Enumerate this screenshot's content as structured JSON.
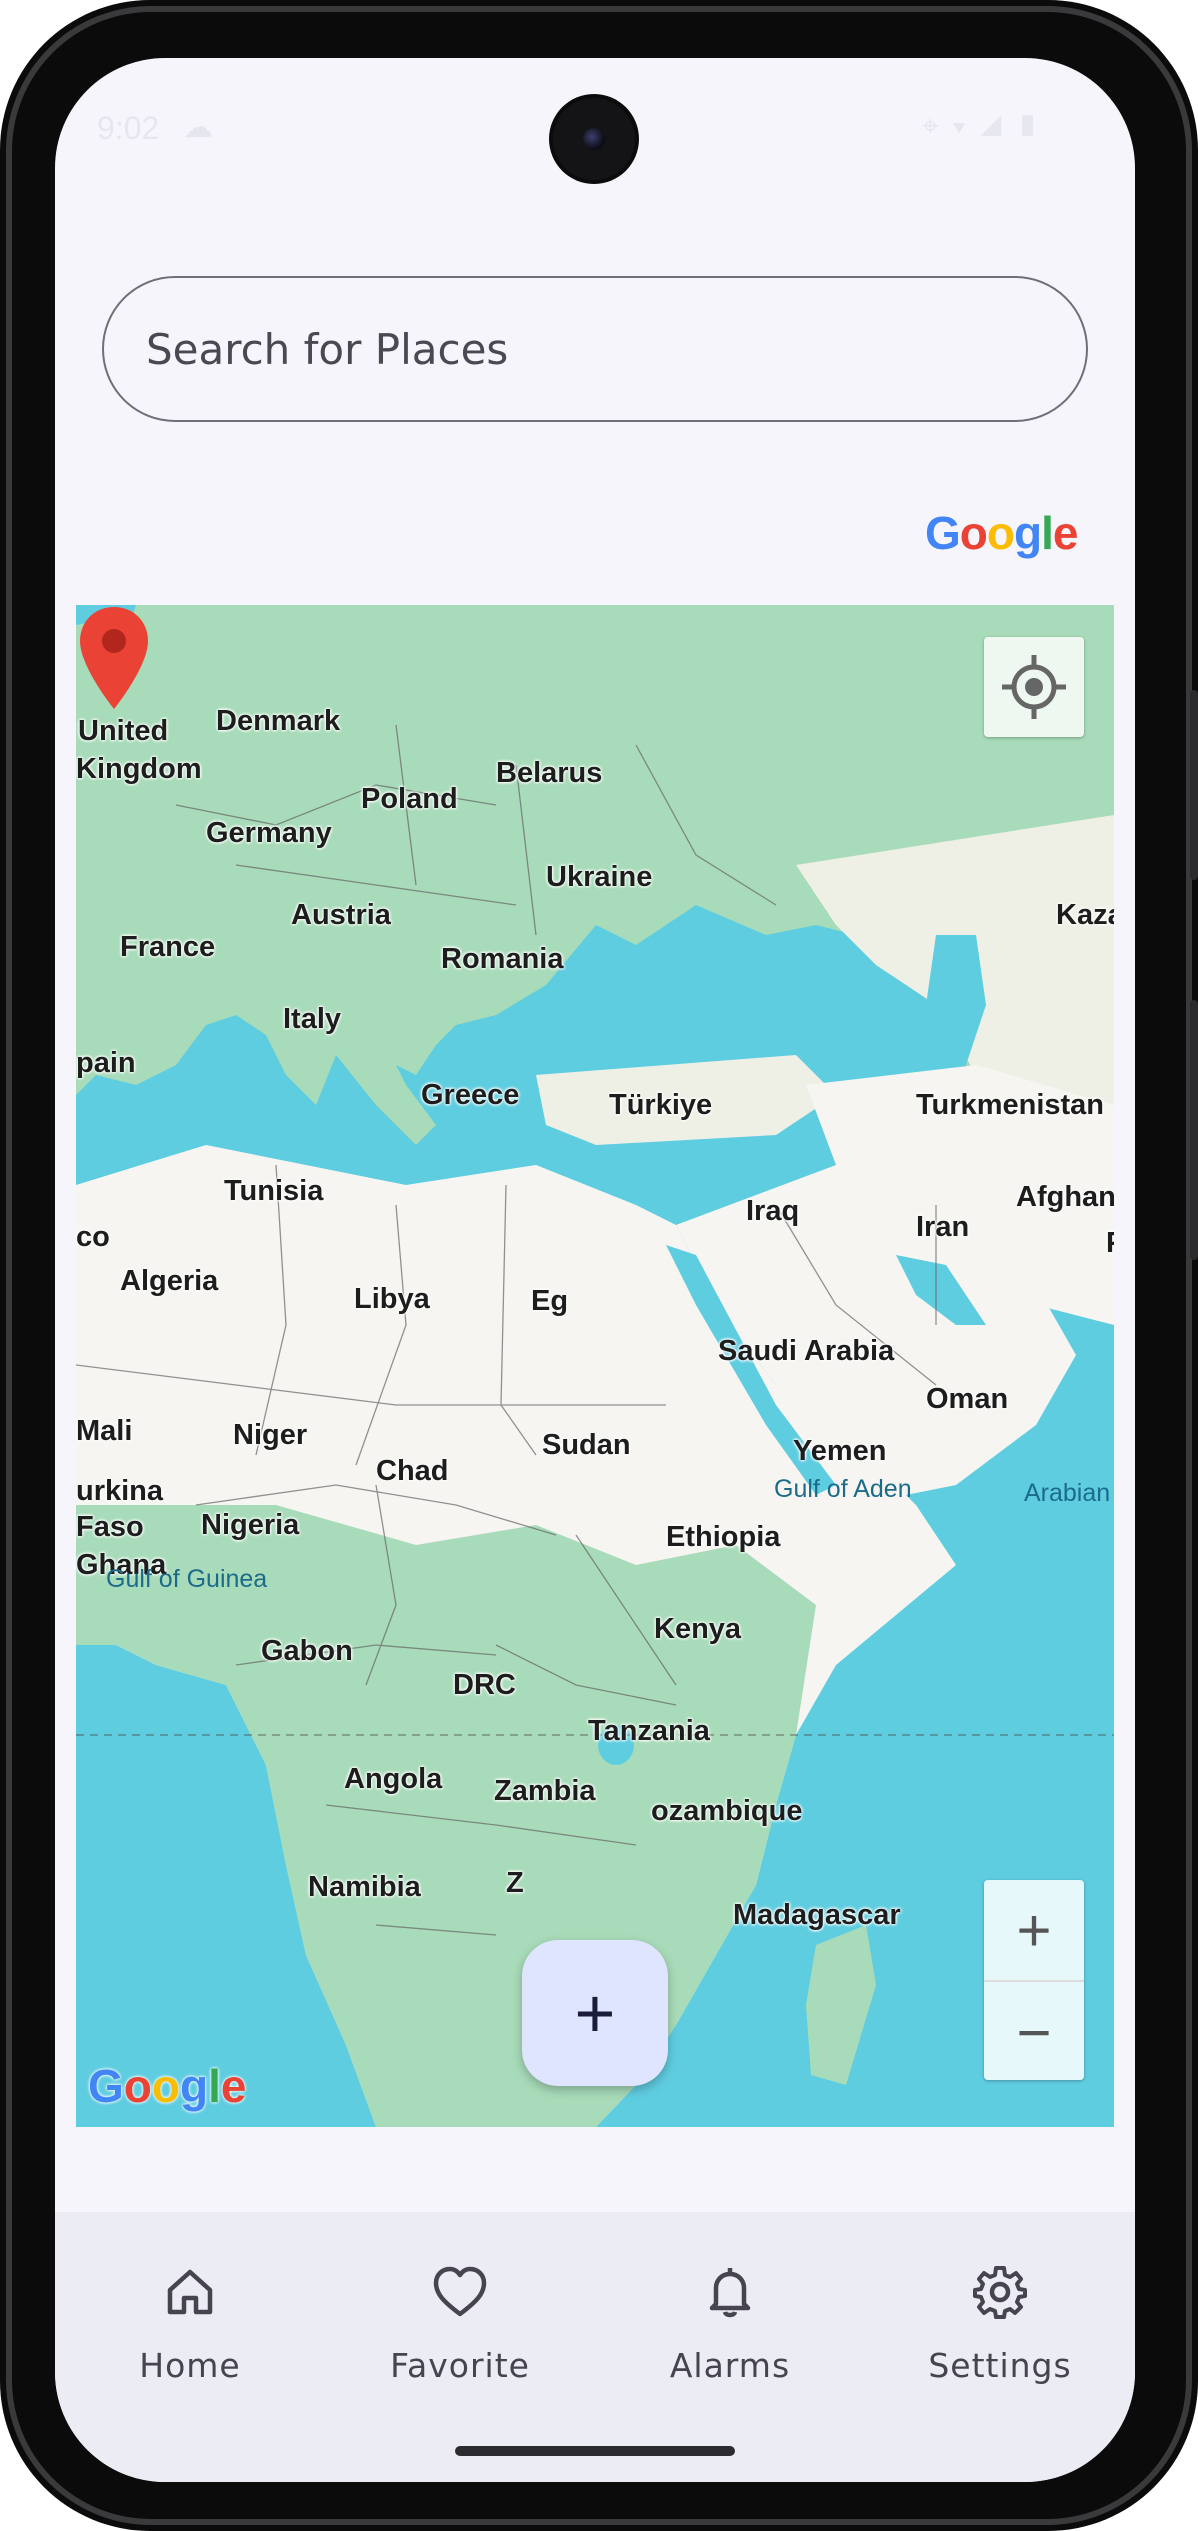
{
  "status_bar": {
    "time": "9:02"
  },
  "search": {
    "placeholder": "Search for Places"
  },
  "attribution": {
    "google": "Google"
  },
  "map": {
    "countries": [
      "United Kingdom",
      "Denmark",
      "Belarus",
      "Poland",
      "Germany",
      "Ukraine",
      "Austria",
      "France",
      "Romania",
      "Italy",
      "Spain",
      "Greece",
      "Türkiye",
      "Turkmenistan",
      "Kazakhstan",
      "Tunisia",
      "Iraq",
      "Iran",
      "Afghanistan",
      "Morocco",
      "Algeria",
      "Libya",
      "Egypt",
      "Saudi Arabia",
      "Oman",
      "Mali",
      "Niger",
      "Sudan",
      "Yemen",
      "Chad",
      "Burkina Faso",
      "Nigeria",
      "Ethiopia",
      "Ghana",
      "Gabon",
      "Kenya",
      "DRC",
      "Tanzania",
      "Angola",
      "Zambia",
      "Mozambique",
      "Namibia",
      "Zimbabwe",
      "Madagascar"
    ],
    "labels": {
      "united": "United",
      "kingdom": "Kingdom",
      "denmark": "Denmark",
      "belarus": "Belarus",
      "poland": "Poland",
      "germany": "Germany",
      "ukraine": "Ukraine",
      "austria": "Austria",
      "kaza": "Kaza",
      "france": "France",
      "romania": "Romania",
      "italy": "Italy",
      "spain": "pain",
      "greece": "Greece",
      "turkiye": "Türkiye",
      "turkmenistan": "Turkmenistan",
      "tunisia": "Tunisia",
      "iraq": "Iraq",
      "iran": "Iran",
      "afghan": "Afghan",
      "morocco": "co",
      "algeria": "Algeria",
      "libya": "Libya",
      "egypt": "Eg",
      "saudi": "Saudi Arabia",
      "oman": "Oman",
      "mali": "Mali",
      "niger": "Niger",
      "sudan": "Sudan",
      "yemen": "Yemen",
      "chad": "Chad",
      "burkina": "urkina",
      "faso": "Faso",
      "nigeria": "Nigeria",
      "ethiopia": "Ethiopia",
      "ghana": "Ghana",
      "gabon": "Gabon",
      "kenya": "Kenya",
      "drc": "DRC",
      "tanzania": "Tanzania",
      "angola": "Angola",
      "zambia": "Zambia",
      "mozambique": "ozambique",
      "namibia": "Namibia",
      "zimbabwe": "Z",
      "madagascar": "Madagascar",
      "p": "P"
    },
    "seas": {
      "gulf_aden": "Gulf of Aden",
      "gulf_guinea": "Gulf of Guinea",
      "arabian": "Arabian"
    },
    "logo": "Google",
    "zoom_in": "+",
    "zoom_out": "−"
  },
  "fab": {
    "label": "+"
  },
  "nav": {
    "items": [
      {
        "label": "Home",
        "icon": "home-icon"
      },
      {
        "label": "Favorite",
        "icon": "heart-icon"
      },
      {
        "label": "Alarms",
        "icon": "bell-icon"
      },
      {
        "label": "Settings",
        "icon": "gear-icon"
      }
    ]
  },
  "colors": {
    "water": "#5fcde0",
    "land": "#f6f5f1",
    "vegetation": "#9fd9b5",
    "marker": "#ea4335",
    "fab": "#dfe4ff",
    "nav_bg": "#ececf4"
  }
}
